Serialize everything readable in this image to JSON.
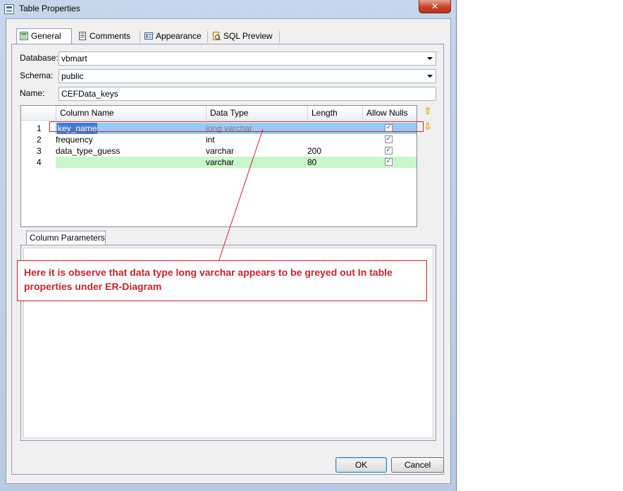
{
  "window": {
    "title": "Table Properties",
    "close_glyph": "✕"
  },
  "tabs": [
    {
      "label": "General",
      "icon": "general-icon"
    },
    {
      "label": "Comments",
      "icon": "comments-icon"
    },
    {
      "label": "Appearance",
      "icon": "appearance-icon"
    },
    {
      "label": "SQL Preview",
      "icon": "sql-preview-icon"
    }
  ],
  "form": {
    "database_label": "Database:",
    "database_value": "vbmart",
    "schema_label": "Schema:",
    "schema_value": "public",
    "name_label": "Name:",
    "name_value": "CEFData_keys"
  },
  "grid": {
    "headers": [
      "Column Name",
      "Data Type",
      "Length",
      "Allow Nulls"
    ],
    "rows": [
      {
        "num": "1",
        "name": "key_name",
        "type": "long varchar",
        "length": "",
        "nulls": "✓"
      },
      {
        "num": "2",
        "name": "frequency",
        "type": "int",
        "length": "",
        "nulls": "✓"
      },
      {
        "num": "3",
        "name": "data_type_guess",
        "type": "varchar",
        "length": "200",
        "nulls": "✓"
      },
      {
        "num": "4",
        "name": "",
        "type": "varchar",
        "length": "80",
        "nulls": "✓"
      }
    ],
    "up_glyph": "⇧",
    "down_glyph": "⇩"
  },
  "column_parameters_tab": "Column Parameters",
  "annotation": "Here it is observe that data type long varchar appears to be greyed out In table properties under ER-Diagram",
  "buttons": {
    "ok": "OK",
    "cancel": "Cancel"
  },
  "colors": {
    "annotation": "#c9252c",
    "selected_row": "#99c9f5",
    "new_row": "#c9f7c9"
  }
}
